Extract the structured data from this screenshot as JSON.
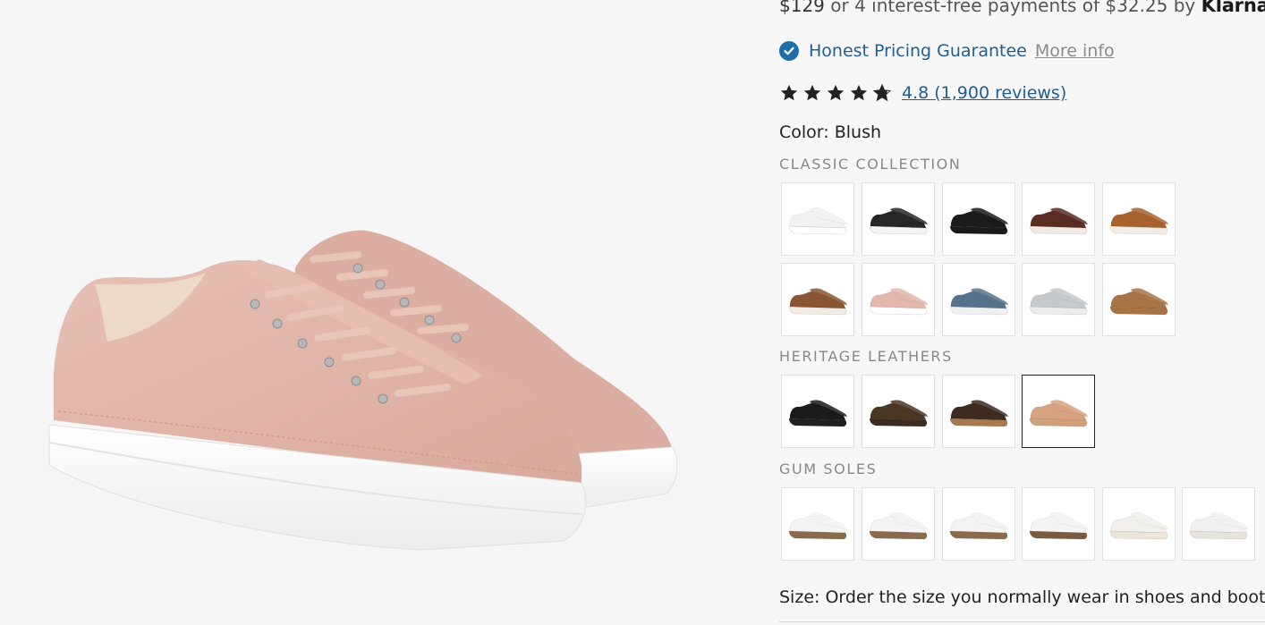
{
  "price": {
    "amount": "$129",
    "installments": " or 4 interest-free payments of $32.25 by ",
    "provider": "Klarna."
  },
  "guarantee": {
    "text": "Honest Pricing Guarantee",
    "link": "More info",
    "icon": "check-circle-icon",
    "color": "#1d6ea8"
  },
  "rating": {
    "stars": 4.8,
    "max_stars": 5,
    "link": "4.8 (1,900 reviews)",
    "star_color": "#222222"
  },
  "color": {
    "label": "Color:",
    "value": "Blush"
  },
  "sections": [
    {
      "title": "CLASSIC COLLECTION",
      "swatches": [
        {
          "upper": "#f2f2f2",
          "sole": "#ffffff"
        },
        {
          "upper": "#262626",
          "sole": "#f4f4f4"
        },
        {
          "upper": "#1b1b1b",
          "sole": "#1b1b1b"
        },
        {
          "upper": "#5a2c22",
          "sole": "#f0e9e4"
        },
        {
          "upper": "#a8622d",
          "sole": "#f3ece6"
        },
        {
          "upper": "#8a5532",
          "sole": "#f1ebe4"
        },
        {
          "upper": "#e3b8ad",
          "sole": "#ffffff"
        },
        {
          "upper": "#56728a",
          "sole": "#f0f0f0"
        },
        {
          "upper": "#c5c9c9",
          "sole": "#ececec"
        },
        {
          "upper": "#a87445",
          "sole": "#a87445"
        }
      ]
    },
    {
      "title": "HERITAGE LEATHERS",
      "swatches": [
        {
          "upper": "#1a1a1a",
          "sole": "#202020"
        },
        {
          "upper": "#4a3624",
          "sole": "#3b2c1f"
        },
        {
          "upper": "#3d2a20",
          "sole": "#a7794f"
        },
        {
          "upper": "#d6a27f",
          "sole": "#cfa07a",
          "selected": true
        }
      ]
    },
    {
      "title": "GUM SOLES",
      "swatches": [
        {
          "upper": "#f4f4f4",
          "sole": "#8a6a4b"
        },
        {
          "upper": "#f4f4f4",
          "sole": "#8a6a4b"
        },
        {
          "upper": "#f4f4f4",
          "sole": "#8a6a4b"
        },
        {
          "upper": "#f4f4f4",
          "sole": "#7a5b40"
        },
        {
          "upper": "#f1f0ec",
          "sole": "#ece6d9"
        },
        {
          "upper": "#f1f1f1",
          "sole": "#e7e4de"
        }
      ]
    }
  ],
  "size": {
    "label": "Size:",
    "text": " Order the size you normally wear in shoes and boots"
  },
  "hero": {
    "product_color": "#e3b8ad",
    "sole_color": "#ffffff"
  }
}
